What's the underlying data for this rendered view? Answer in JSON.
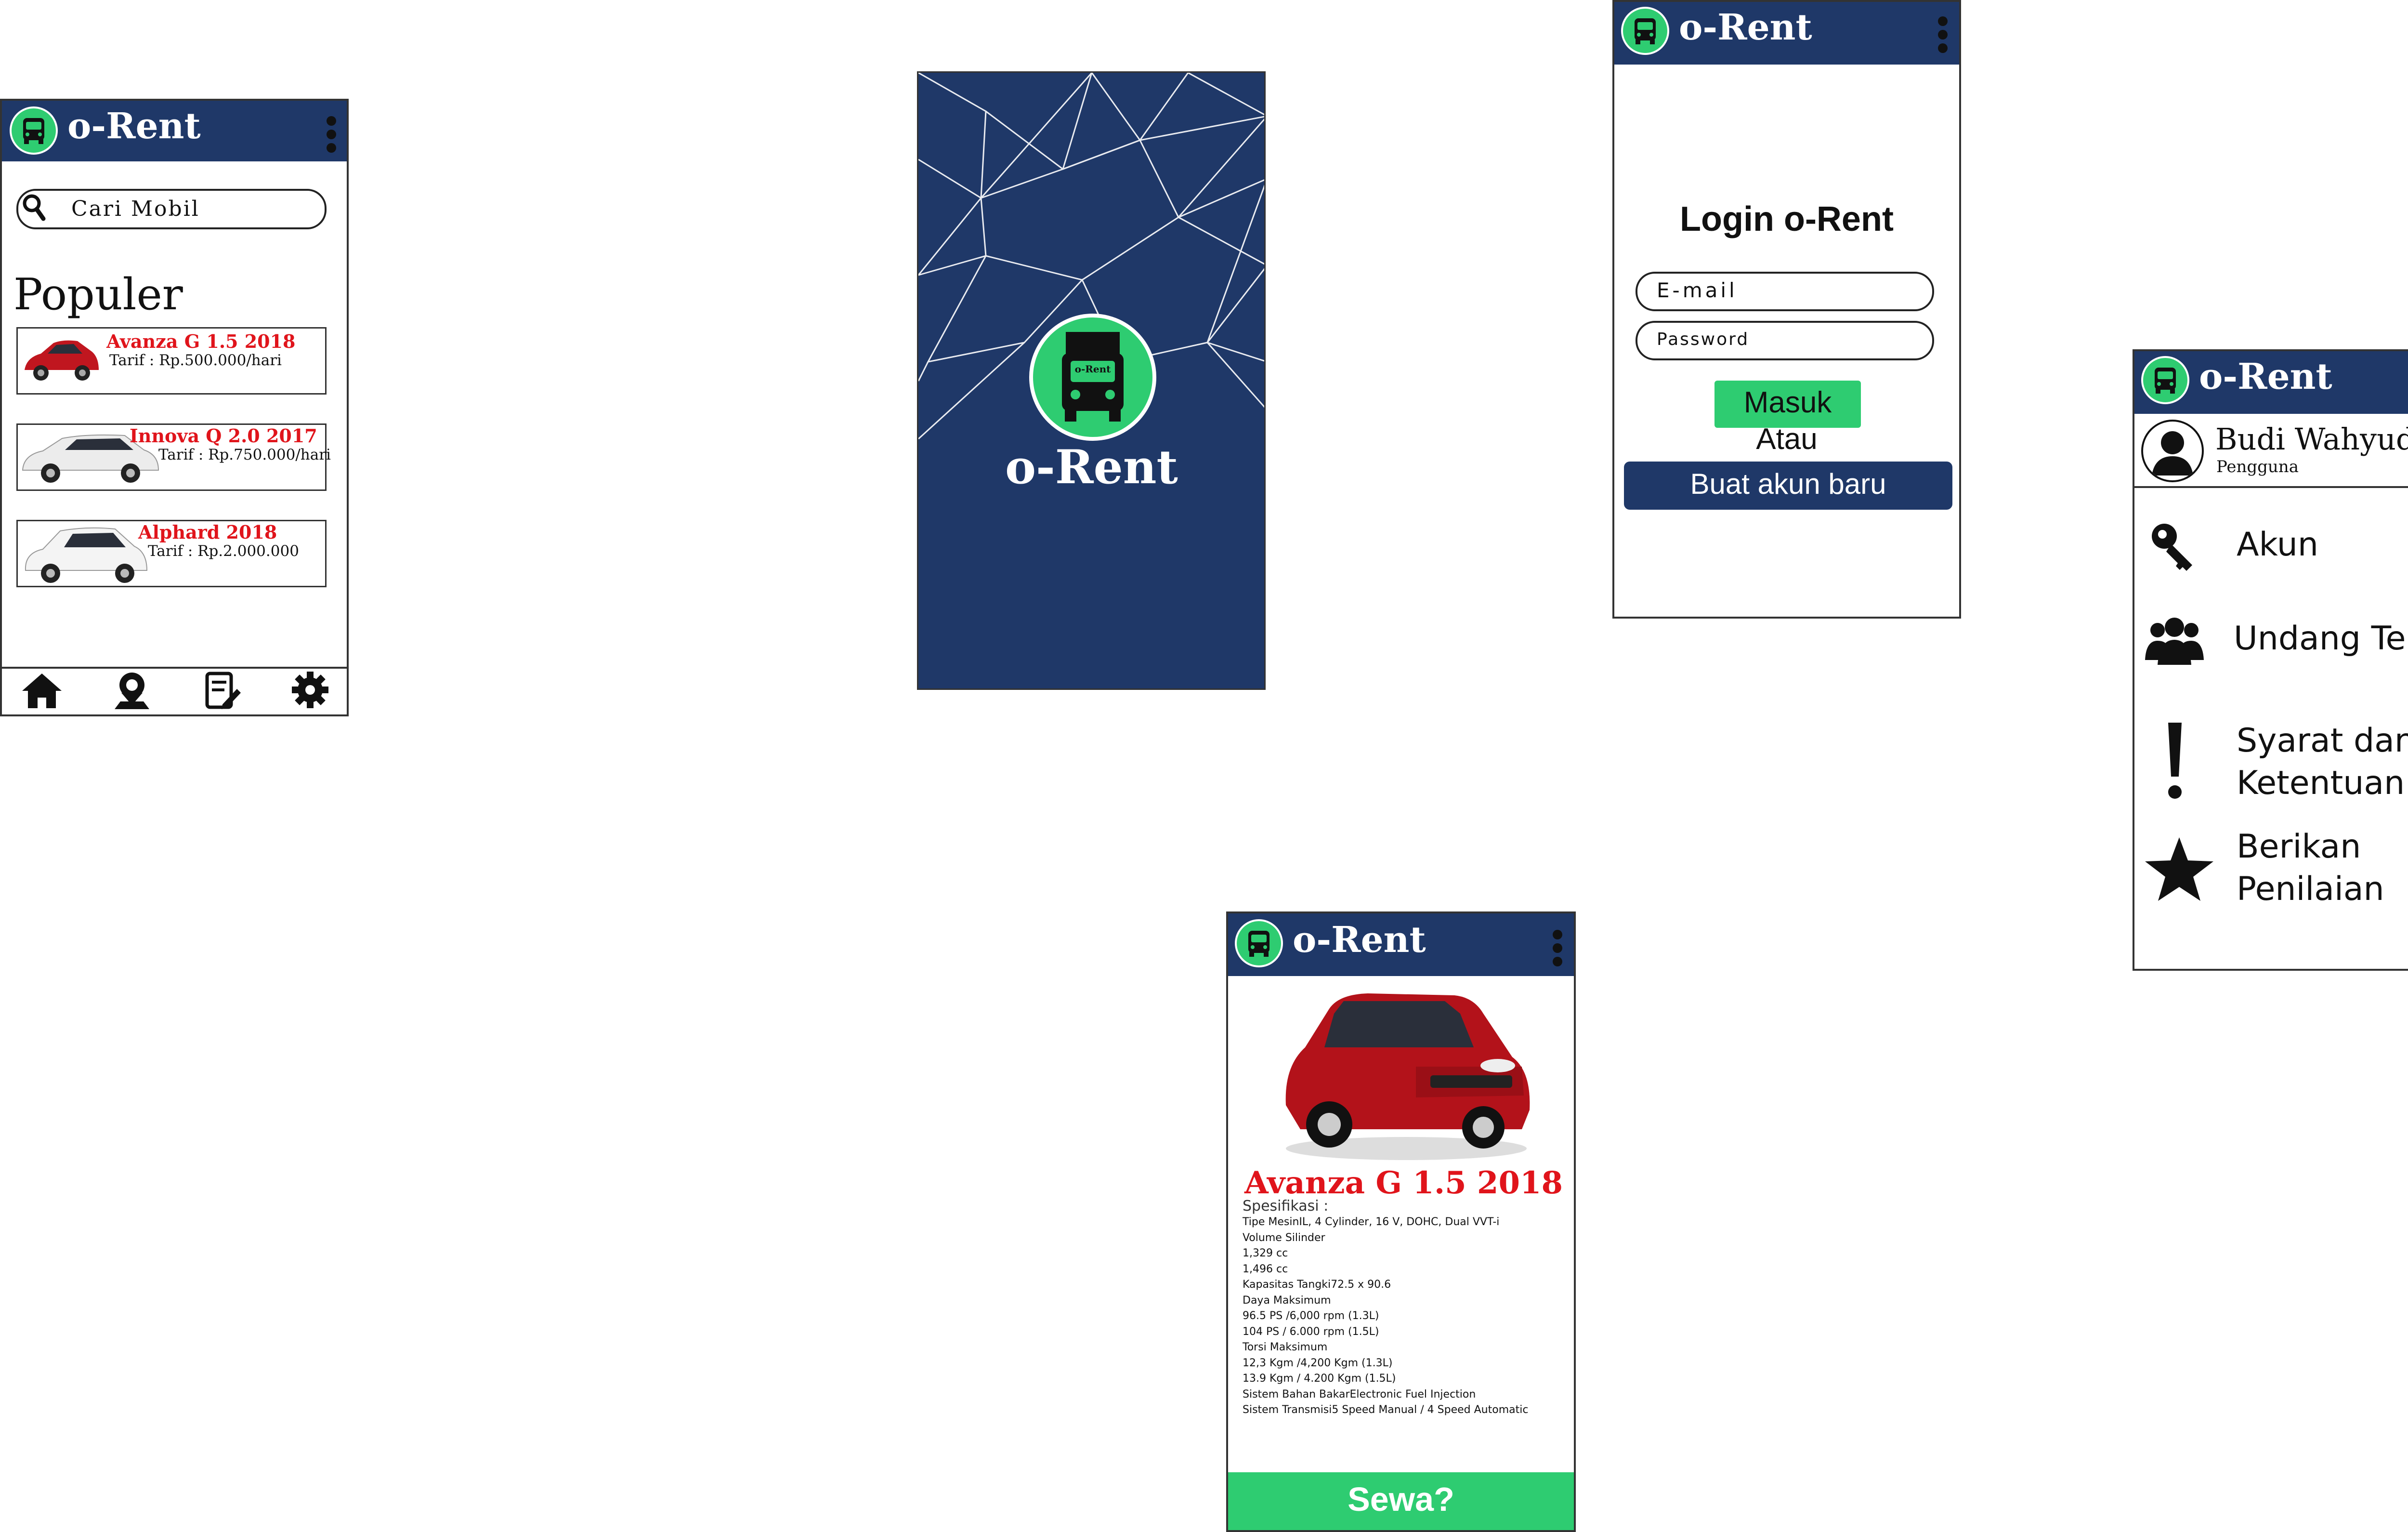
{
  "brand": {
    "name": "o-Rent",
    "logo_text": "o-Rent",
    "colors": {
      "navy": "#1f3868",
      "green": "#2ecc71",
      "red": "#e0141b"
    }
  },
  "home": {
    "search_placeholder": "Cari Mobil",
    "section_title": "Populer",
    "cars": [
      {
        "name": "Avanza G 1.5 2018",
        "rate": "Tarif : Rp.500.000/hari",
        "color": "#c0161f"
      },
      {
        "name": "Innova Q 2.0 2017",
        "rate": "Tarif : Rp.750.000/hari",
        "color": "#e8e8e8"
      },
      {
        "name": "Alphard 2018",
        "rate": "Tarif : Rp.2.000.000",
        "color": "#f2f2f2"
      }
    ],
    "bottom_nav": [
      {
        "icon": "home-icon"
      },
      {
        "icon": "map-pin-icon"
      },
      {
        "icon": "edit-note-icon"
      },
      {
        "icon": "gear-icon"
      }
    ]
  },
  "splash": {
    "brand": "o-Rent"
  },
  "login": {
    "title": "Login o-Rent",
    "email_placeholder": "E-mail",
    "password_placeholder": "Password",
    "submit_label": "Masuk",
    "or_label": "Atau",
    "register_label": "Buat akun baru"
  },
  "profile": {
    "user_name": "Budi Wahyudi",
    "user_role": "Pengguna",
    "menu": [
      {
        "label": "Akun",
        "icon": "key-icon"
      },
      {
        "label": "Undang Teman",
        "icon": "users-icon"
      },
      {
        "label": "Syarat dan Ketentuan",
        "icon": "exclamation-icon"
      },
      {
        "label": "Berikan Penilaian",
        "icon": "star-icon"
      }
    ]
  },
  "detail": {
    "car_name": "Avanza G 1.5 2018",
    "spec_title": "Spesifikasi :",
    "specs": [
      "Tipe MesinIL, 4 Cylinder, 16 V, DOHC, Dual VVT-i",
      "Volume Silinder",
      "1,329 cc",
      "1,496 cc",
      "Kapasitas Tangki72.5 x 90.6",
      "Daya Maksimum",
      "96.5 PS /6,000 rpm (1.3L)",
      "104 PS / 6.000 rpm (1.5L)",
      "Torsi Maksimum",
      "12,3 Kgm /4,200 Kgm (1.3L)",
      "13.9 Kgm / 4.200 Kgm (1.5L)",
      "Sistem Bahan BakarElectronic Fuel Injection",
      "Sistem Transmisi5 Speed Manual / 4 Speed Automatic"
    ],
    "cta_label": "Sewa?"
  }
}
